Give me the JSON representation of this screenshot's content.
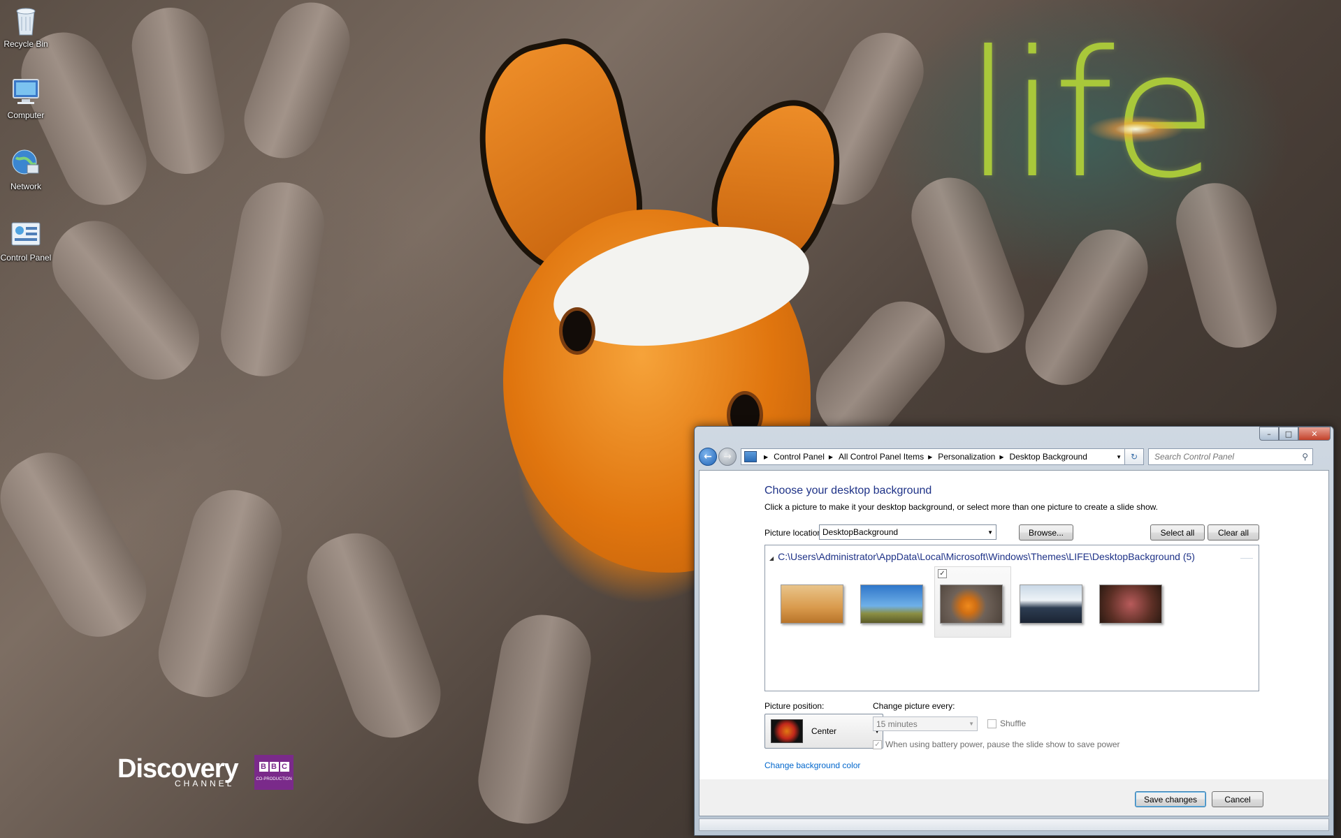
{
  "desktop": {
    "icons": [
      {
        "name": "recycle-bin",
        "label": "Recycle Bin"
      },
      {
        "name": "computer",
        "label": "Computer"
      },
      {
        "name": "network",
        "label": "Network"
      },
      {
        "name": "control-panel",
        "label": "Control Panel"
      }
    ],
    "wallpaper_logo": "life",
    "discovery": "Discovery",
    "discovery_sub": "CHANNEL",
    "bbc_letters": [
      "B",
      "B",
      "C"
    ],
    "bbc_sub": "CO-PRODUCTION"
  },
  "window": {
    "controls": {
      "minimize": "–",
      "maximize": "□",
      "close": "✕"
    },
    "address": {
      "crumbs": [
        "Control Panel",
        "All Control Panel Items",
        "Personalization",
        "Desktop Background"
      ]
    },
    "search": {
      "placeholder": "Search Control Panel"
    },
    "title": "Choose your desktop background",
    "subtitle": "Click a picture to make it your desktop background, or select more than one picture to create a slide show.",
    "picture_location_label": "Picture location:",
    "picture_location_value": "DesktopBackground",
    "browse_label": "Browse...",
    "select_all_label": "Select all",
    "clear_all_label": "Clear all",
    "folder_path": "C:\\Users\\Administrator\\AppData\\Local\\Microsoft\\Windows\\Themes\\LIFE\\DesktopBackground (5)",
    "thumbnails": [
      {
        "name": "desert-chameleon",
        "selected": false
      },
      {
        "name": "dragon-tree",
        "selected": false
      },
      {
        "name": "clownfish",
        "selected": true
      },
      {
        "name": "penguin-shore",
        "selected": false
      },
      {
        "name": "red-coral",
        "selected": false
      }
    ],
    "picture_position_label": "Picture position:",
    "picture_position_value": "Center",
    "change_every_label": "Change picture every:",
    "change_every_value": "15 minutes",
    "shuffle_label": "Shuffle",
    "shuffle_checked": false,
    "battery_label": "When using battery power, pause the slide show to save power",
    "battery_checked": true,
    "change_color_link": "Change background color",
    "save_label": "Save changes",
    "cancel_label": "Cancel"
  }
}
